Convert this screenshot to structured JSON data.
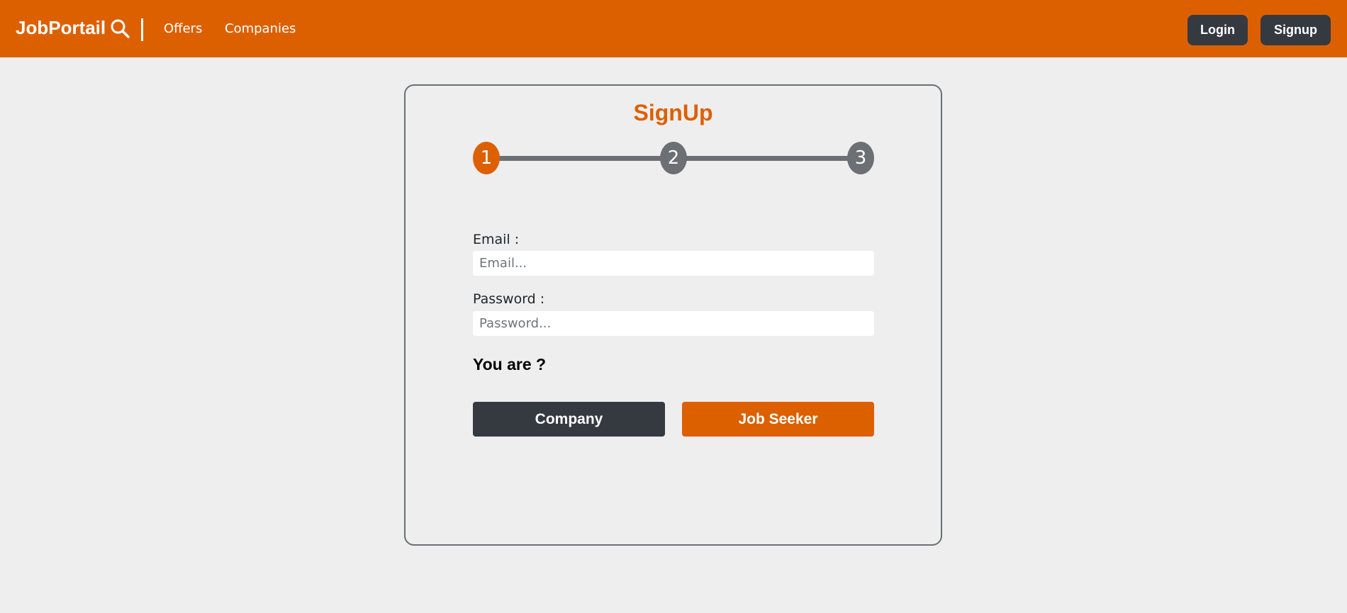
{
  "colors": {
    "brand": "#dd6000",
    "dark": "#343a40",
    "step_inactive": "#6c6f74",
    "background": "#eeeeee"
  },
  "navbar": {
    "brand": "JobPortail",
    "brand_icon": "search-icon",
    "links": [
      {
        "label": "Offers"
      },
      {
        "label": "Companies"
      }
    ],
    "login_label": "Login",
    "signup_label": "Signup"
  },
  "signup": {
    "title": "SignUp",
    "steps": [
      {
        "number": "1",
        "active": true
      },
      {
        "number": "2",
        "active": false
      },
      {
        "number": "3",
        "active": false
      }
    ],
    "email": {
      "label": "Email :",
      "placeholder": "Email...",
      "value": ""
    },
    "password": {
      "label": "Password :",
      "placeholder": "Password...",
      "value": ""
    },
    "role_question": "You are ?",
    "company_label": "Company",
    "job_seeker_label": "Job Seeker"
  }
}
